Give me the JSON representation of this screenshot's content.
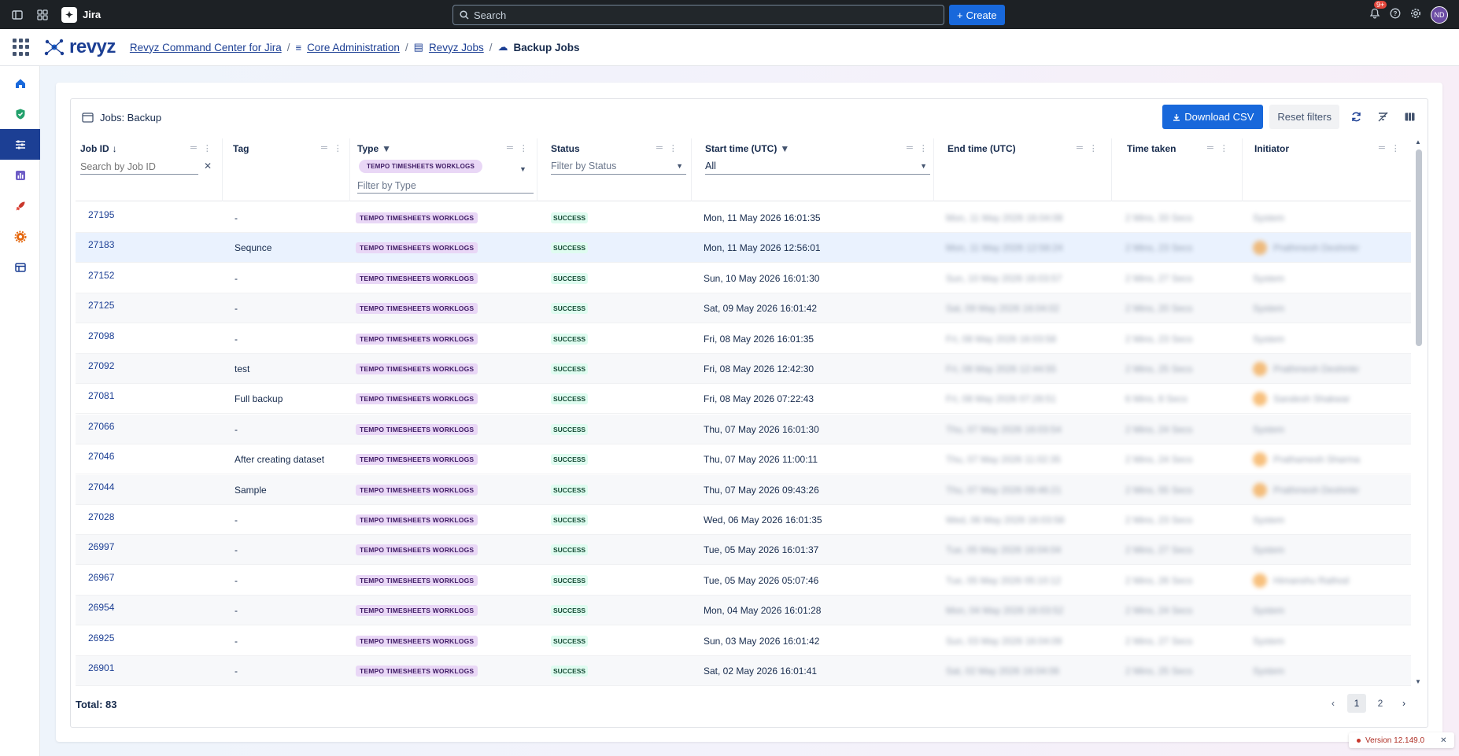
{
  "topbar": {
    "product": "Jira",
    "search_placeholder": "Search",
    "create_label": "Create",
    "notif_count": "9+",
    "avatar_initials": "ND"
  },
  "appbar": {
    "brand": "revyz",
    "breadcrumbs": [
      {
        "label": "Revyz Command Center for Jira",
        "icon": "none"
      },
      {
        "label": "Core Administration",
        "icon": "sliders-icon"
      },
      {
        "label": "Revyz Jobs",
        "icon": "list-icon"
      },
      {
        "label": "Backup Jobs",
        "icon": "cloud-icon"
      }
    ]
  },
  "sidebar": {
    "items": [
      {
        "name": "home-icon",
        "color": "#1868db"
      },
      {
        "name": "shield-icon",
        "color": "#22a06b"
      },
      {
        "name": "sliders-icon",
        "color": "#ffffff",
        "active": true
      },
      {
        "name": "reports-icon",
        "color": "#6e5dc6"
      },
      {
        "name": "rocket-icon",
        "color": "#c9372c"
      },
      {
        "name": "gear-icon",
        "color": "#e56910"
      },
      {
        "name": "table-icon",
        "color": "#1c3f94"
      }
    ]
  },
  "panel": {
    "title": "Jobs: Backup",
    "download_label": "Download CSV",
    "reset_label": "Reset filters"
  },
  "table": {
    "columns": {
      "job_id": "Job ID",
      "tag": "Tag",
      "type": "Type",
      "status": "Status",
      "start": "Start time (UTC)",
      "end": "End time (UTC)",
      "taken": "Time taken",
      "initiator": "Initiator"
    },
    "filters": {
      "job_id_placeholder": "Search by Job ID",
      "type_chip": "TEMPO TIMESHEETS WORKLOGS",
      "type_placeholder": "Filter by Type",
      "status_placeholder": "Filter by Status",
      "start_value": "All"
    },
    "rows": [
      {
        "id": "27195",
        "tag": "-",
        "type": "TEMPO TIMESHEETS WORKLOGS",
        "status": "SUCCESS",
        "start": "Mon, 11 May 2026 16:01:35",
        "end": "Mon, 11 May 2026 16:04:08",
        "taken": "2 Mins, 33 Secs",
        "initiator": "System",
        "avatar": false
      },
      {
        "id": "27183",
        "tag": "Sequnce",
        "type": "TEMPO TIMESHEETS WORKLOGS",
        "status": "SUCCESS",
        "start": "Mon, 11 May 2026 12:56:01",
        "end": "Mon, 11 May 2026 12:58:24",
        "taken": "2 Mins, 23 Secs",
        "initiator": "Prathmesh Deshmkr",
        "avatar": true
      },
      {
        "id": "27152",
        "tag": "-",
        "type": "TEMPO TIMESHEETS WORKLOGS",
        "status": "SUCCESS",
        "start": "Sun, 10 May 2026 16:01:30",
        "end": "Sun, 10 May 2026 16:03:57",
        "taken": "2 Mins, 27 Secs",
        "initiator": "System",
        "avatar": false
      },
      {
        "id": "27125",
        "tag": "-",
        "type": "TEMPO TIMESHEETS WORKLOGS",
        "status": "SUCCESS",
        "start": "Sat, 09 May 2026 16:01:42",
        "end": "Sat, 09 May 2026 16:04:02",
        "taken": "2 Mins, 20 Secs",
        "initiator": "System",
        "avatar": false
      },
      {
        "id": "27098",
        "tag": "-",
        "type": "TEMPO TIMESHEETS WORKLOGS",
        "status": "SUCCESS",
        "start": "Fri, 08 May 2026 16:01:35",
        "end": "Fri, 08 May 2026 16:03:58",
        "taken": "2 Mins, 23 Secs",
        "initiator": "System",
        "avatar": false
      },
      {
        "id": "27092",
        "tag": "test",
        "type": "TEMPO TIMESHEETS WORKLOGS",
        "status": "SUCCESS",
        "start": "Fri, 08 May 2026 12:42:30",
        "end": "Fri, 08 May 2026 12:44:55",
        "taken": "2 Mins, 25 Secs",
        "initiator": "Prathmesh Deshmkr",
        "avatar": true
      },
      {
        "id": "27081",
        "tag": "Full backup",
        "type": "TEMPO TIMESHEETS WORKLOGS",
        "status": "SUCCESS",
        "start": "Fri, 08 May 2026 07:22:43",
        "end": "Fri, 08 May 2026 07:28:51",
        "taken": "6 Mins, 8 Secs",
        "initiator": "Sandesh Shakwar",
        "avatar": true
      },
      {
        "id": "27066",
        "tag": "-",
        "type": "TEMPO TIMESHEETS WORKLOGS",
        "status": "SUCCESS",
        "start": "Thu, 07 May 2026 16:01:30",
        "end": "Thu, 07 May 2026 16:03:54",
        "taken": "2 Mins, 24 Secs",
        "initiator": "System",
        "avatar": false
      },
      {
        "id": "27046",
        "tag": "After creating dataset",
        "type": "TEMPO TIMESHEETS WORKLOGS",
        "status": "SUCCESS",
        "start": "Thu, 07 May 2026 11:00:11",
        "end": "Thu, 07 May 2026 11:02:35",
        "taken": "2 Mins, 24 Secs",
        "initiator": "Prathamesh Sharma",
        "avatar": true
      },
      {
        "id": "27044",
        "tag": "Sample",
        "type": "TEMPO TIMESHEETS WORKLOGS",
        "status": "SUCCESS",
        "start": "Thu, 07 May 2026 09:43:26",
        "end": "Thu, 07 May 2026 09:46:21",
        "taken": "2 Mins, 55 Secs",
        "initiator": "Prathmesh Deshmkr",
        "avatar": true
      },
      {
        "id": "27028",
        "tag": "-",
        "type": "TEMPO TIMESHEETS WORKLOGS",
        "status": "SUCCESS",
        "start": "Wed, 06 May 2026 16:01:35",
        "end": "Wed, 06 May 2026 16:03:58",
        "taken": "2 Mins, 23 Secs",
        "initiator": "System",
        "avatar": false
      },
      {
        "id": "26997",
        "tag": "-",
        "type": "TEMPO TIMESHEETS WORKLOGS",
        "status": "SUCCESS",
        "start": "Tue, 05 May 2026 16:01:37",
        "end": "Tue, 05 May 2026 16:04:04",
        "taken": "2 Mins, 27 Secs",
        "initiator": "System",
        "avatar": false
      },
      {
        "id": "26967",
        "tag": "-",
        "type": "TEMPO TIMESHEETS WORKLOGS",
        "status": "SUCCESS",
        "start": "Tue, 05 May 2026 05:07:46",
        "end": "Tue, 05 May 2026 05:10:12",
        "taken": "2 Mins, 26 Secs",
        "initiator": "Himanshu Rathod",
        "avatar": true
      },
      {
        "id": "26954",
        "tag": "-",
        "type": "TEMPO TIMESHEETS WORKLOGS",
        "status": "SUCCESS",
        "start": "Mon, 04 May 2026 16:01:28",
        "end": "Mon, 04 May 2026 16:03:52",
        "taken": "2 Mins, 24 Secs",
        "initiator": "System",
        "avatar": false
      },
      {
        "id": "26925",
        "tag": "-",
        "type": "TEMPO TIMESHEETS WORKLOGS",
        "status": "SUCCESS",
        "start": "Sun, 03 May 2026 16:01:42",
        "end": "Sun, 03 May 2026 16:04:09",
        "taken": "2 Mins, 27 Secs",
        "initiator": "System",
        "avatar": false
      },
      {
        "id": "26901",
        "tag": "-",
        "type": "TEMPO TIMESHEETS WORKLOGS",
        "status": "SUCCESS",
        "start": "Sat, 02 May 2026 16:01:41",
        "end": "Sat, 02 May 2026 16:04:06",
        "taken": "2 Mins, 25 Secs",
        "initiator": "System",
        "avatar": false
      }
    ]
  },
  "footer": {
    "total_label": "Total: 83",
    "pages": [
      "1",
      "2"
    ],
    "current_page": "1"
  },
  "version": {
    "label": "Version 12.149.0"
  }
}
